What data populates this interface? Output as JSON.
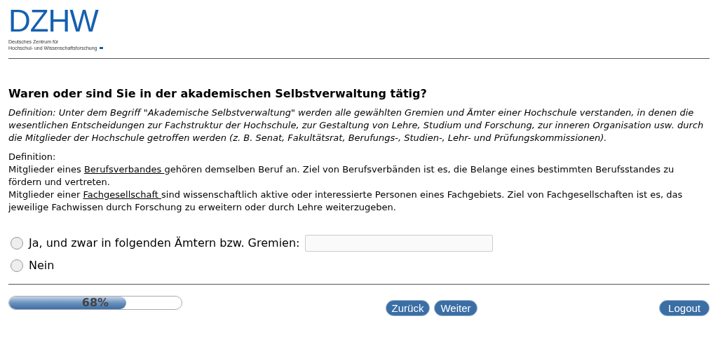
{
  "logo": {
    "mark": "DZHW",
    "lines": [
      "Deutsches Zentrum für",
      "Hochschul- und Wissenschaftsforschung"
    ]
  },
  "question": {
    "title": "Waren oder sind Sie in der akademischen Selbstverwaltung tätig?",
    "definition": "Definition: Unter dem Begriff \"Akademische Selbstverwaltung\" werden alle gewählten Gremien und Ämter einer Hochschule verstanden, in denen die wesentlichen Entscheidungen zur Fachstruktur der Hochschule, zur Gestaltung von Lehre, Studium und Forschung, zur inneren Organisation usw. durch die Mitglieder der Hochschule getroffen werden (z. B. Senat, Fakultätsrat, Berufungs-, Studien-, Lehr- und Prüfungskommissionen).",
    "note_heading": "Definition:",
    "note_paragraphs": [
      [
        {
          "kind": "text",
          "text": "Mitglieder eines "
        },
        {
          "kind": "term",
          "text": "Berufsverbandes "
        },
        {
          "kind": "text",
          "text": "gehören demselben Beruf an. Ziel von Berufsverbänden ist es, die Belange eines bestimmten Berufsstandes zu fördern und vertreten."
        }
      ],
      [
        {
          "kind": "text",
          "text": "Mitglieder einer "
        },
        {
          "kind": "term",
          "text": "Fachgesellschaft "
        },
        {
          "kind": "text",
          "text": "sind wissenschaftlich aktive oder interessierte Personen eines Fachgebiets. Ziel von Fachgesellschaften ist es, das jeweilige Fachwissen durch Forschung zu erweitern oder durch Lehre weiterzugeben."
        }
      ]
    ]
  },
  "options": [
    {
      "label": "Ja, und zwar in folgenden Ämtern bzw. Gremien:",
      "selected": false,
      "kind": "with_field"
    },
    {
      "label": "Nein",
      "selected": false,
      "kind": "plain"
    }
  ],
  "progress": {
    "level": 0.68,
    "label": "68%"
  },
  "buttons": {
    "back": "Zurück",
    "next": "Weiter",
    "logout": "Logout"
  }
}
